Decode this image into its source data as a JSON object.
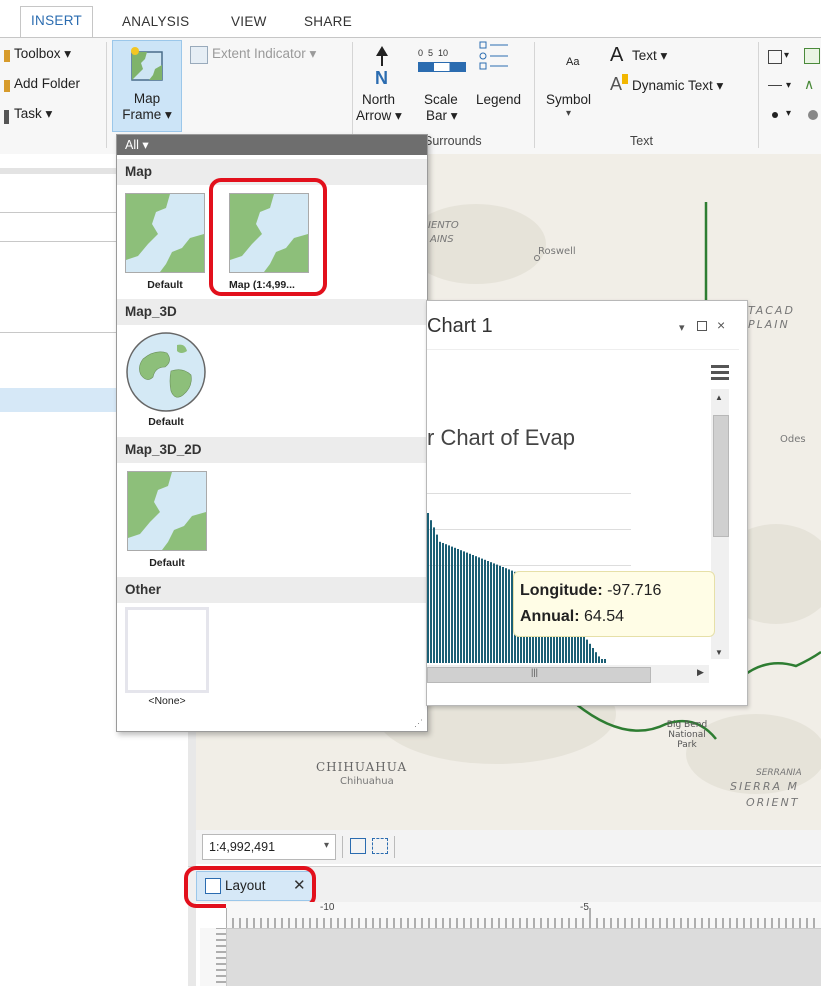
{
  "ribbon_tabs": [
    "INSERT",
    "ANALYSIS",
    "VIEW",
    "SHARE"
  ],
  "ribbon": {
    "toolbox": "Toolbox ▾",
    "add_folder": "Add Folder",
    "task": "Task ▾",
    "map_frame_line1": "Map",
    "map_frame_line2": "Frame ▾",
    "extent_indicator": "Extent Indicator ▾",
    "north_arrow_line1": "North",
    "north_arrow_line2": "Arrow ▾",
    "scale_bar_numbers": "0  5  10",
    "scale_bar_line1": "Scale",
    "scale_bar_line2": "Bar ▾",
    "legend": "Legend",
    "symbol_aa": "Aa",
    "symbol": "Symbol",
    "symbol_dd": "▾",
    "text": "Text ▾",
    "dynamic_text": "Dynamic Text ▾",
    "group_surrounds": "Surrounds",
    "group_text": "Text"
  },
  "gallery": {
    "header": "All ▾",
    "sections": [
      {
        "title": "Map",
        "items": [
          "Default",
          "Map (1:4,99..."
        ]
      },
      {
        "title": "Map_3D",
        "items": [
          "Default"
        ]
      },
      {
        "title": "Map_3D_2D",
        "items": [
          "Default"
        ]
      },
      {
        "title": "Other",
        "items": [
          "<None>"
        ]
      }
    ]
  },
  "chart_window": {
    "title": "Chart 1",
    "chart_title": "r Chart of Evap",
    "tooltip": {
      "label1": "Longitude:",
      "value1": "-97.716",
      "label2": "Annual:",
      "value2": "64.54"
    }
  },
  "map_labels": {
    "ento": "IENTO",
    "ains": "AINS",
    "roswell": "Roswell",
    "tacad": "TACAD",
    "plain": "PLAIN",
    "odes": "Odes",
    "chihuahua_state": "CHIHUAHUA",
    "chihuahua_city": "Chihuahua",
    "big_bend": "Big Bend National Park",
    "serrania": "SERRANIA",
    "sierra": "SIERRA M",
    "orient": "ORIENT"
  },
  "map_scale": "1:4,992,491",
  "layout_tab": "Layout",
  "ruler": {
    "tick1": "-10",
    "tick2": "-5"
  },
  "colors": {
    "accent_blue": "#2b6cb0",
    "highlight_red": "#e2101c",
    "button_selected": "#cce4f7",
    "map_green": "#8dbf7a",
    "boundary_green": "#2e7d32"
  }
}
